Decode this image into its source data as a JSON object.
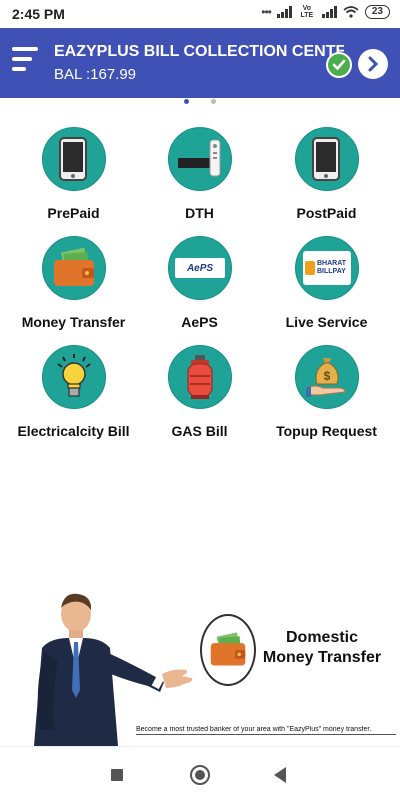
{
  "status_bar": {
    "time": "2:45 PM",
    "network": "Vo LTE",
    "battery": "23"
  },
  "header": {
    "title": "EAZYPLUS BILL COLLECTION CENTER",
    "balance": "BAL :167.99",
    "bg_color": "#3f51b5"
  },
  "pager": {
    "count": 2,
    "active": 1
  },
  "services": [
    {
      "label": "PrePaid",
      "icon": "mobile-phone-icon"
    },
    {
      "label": "DTH",
      "icon": "dth-settop-box-icon"
    },
    {
      "label": "PostPaid",
      "icon": "mobile-phone-icon"
    },
    {
      "label": "Money Transfer",
      "icon": "wallet-icon"
    },
    {
      "label": "AePS",
      "icon": "aeps-logo-icon",
      "logo_text": "AePS"
    },
    {
      "label": "Live Service",
      "icon": "bharat-billpay-icon",
      "logo_text": "BHARAT BILLPAY"
    },
    {
      "label": "Electricalcity Bill",
      "icon": "light-bulb-icon"
    },
    {
      "label": "GAS Bill",
      "icon": "gas-cylinder-icon"
    },
    {
      "label": "Topup Request",
      "icon": "money-bag-hand-icon"
    }
  ],
  "banner": {
    "title_line1": "Domestic",
    "title_line2": "Money Transfer",
    "caption": "Become a most trusted banker of your area with \"EazyPlus\" money transfer."
  },
  "colors": {
    "tile_circle": "#1fa397",
    "accent": "#3f51b5",
    "check": "#4cae4c"
  }
}
